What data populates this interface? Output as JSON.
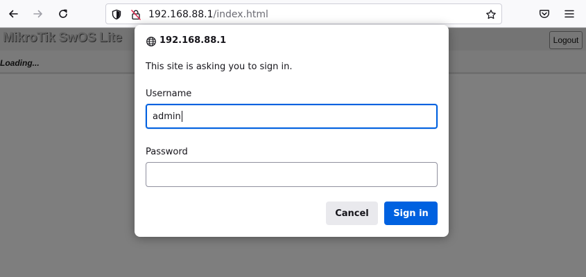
{
  "browser": {
    "url_host": "192.168.88.1",
    "url_path": "/index.html"
  },
  "page": {
    "title": "MikroTik SwOS Lite",
    "logout_label": "Logout",
    "status": "Loading..."
  },
  "dialog": {
    "host": "192.168.88.1",
    "message": "This site is asking you to sign in.",
    "username_label": "Username",
    "username_value": "admin",
    "password_label": "Password",
    "password_value": "",
    "cancel_label": "Cancel",
    "signin_label": "Sign in"
  },
  "colors": {
    "accent": "#0061e0",
    "overlay": "#7f7f7f"
  },
  "icons": {
    "back": "arrow-left-icon",
    "forward": "arrow-right-icon",
    "reload": "reload-icon",
    "tracking": "shield-icon",
    "insecure": "insecure-lock-icon",
    "bookmark": "star-icon",
    "pocket": "pocket-icon",
    "menu": "hamburger-menu-icon",
    "site": "globe-icon"
  }
}
